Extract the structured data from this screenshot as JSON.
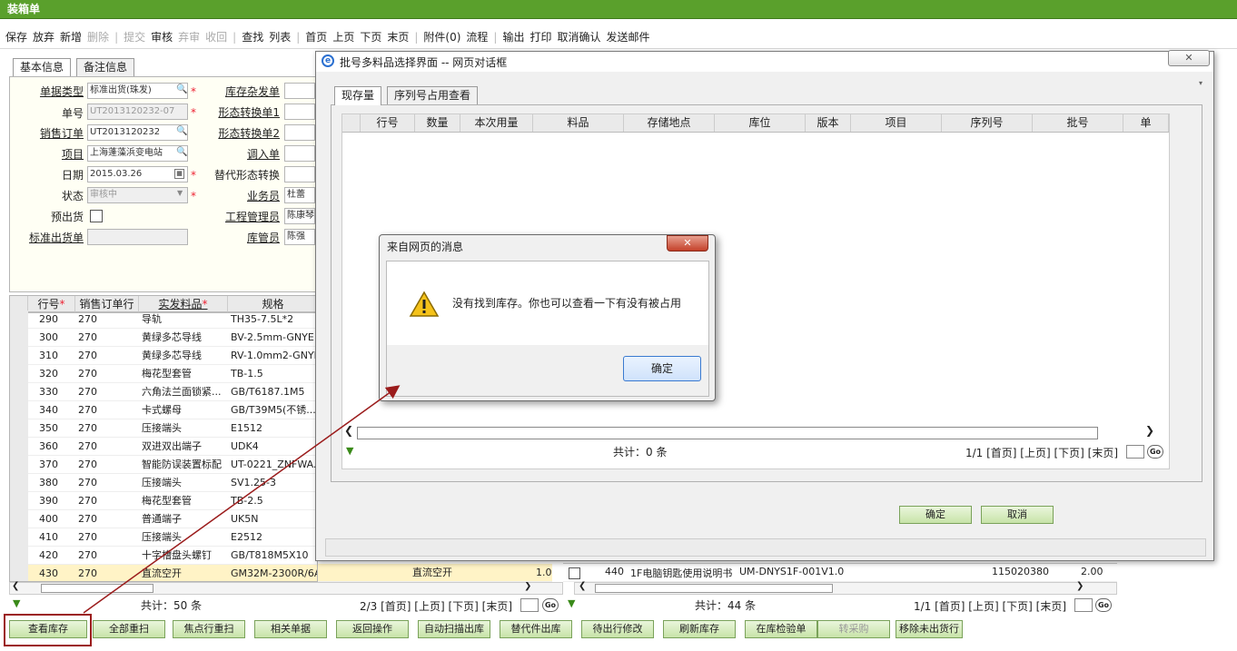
{
  "app": {
    "title": "装箱单"
  },
  "toolbar": [
    {
      "label": "保存",
      "enabled": true
    },
    {
      "label": "放弃",
      "enabled": true
    },
    {
      "label": "新增",
      "enabled": true
    },
    {
      "label": "删除",
      "enabled": false
    },
    {
      "sep": true
    },
    {
      "label": "提交",
      "enabled": false
    },
    {
      "label": "审核",
      "enabled": true
    },
    {
      "label": "弃审",
      "enabled": false
    },
    {
      "label": "收回",
      "enabled": false
    },
    {
      "sep": true
    },
    {
      "label": "查找",
      "enabled": true
    },
    {
      "label": "列表",
      "enabled": true
    },
    {
      "sep": true
    },
    {
      "label": "首页",
      "enabled": true
    },
    {
      "label": "上页",
      "enabled": true
    },
    {
      "label": "下页",
      "enabled": true
    },
    {
      "label": "末页",
      "enabled": true
    },
    {
      "sep": true
    },
    {
      "label": "附件(0)",
      "enabled": true
    },
    {
      "label": "流程",
      "enabled": true
    },
    {
      "sep": true
    },
    {
      "label": "输出",
      "enabled": true
    },
    {
      "label": "打印",
      "enabled": true
    },
    {
      "label": "取消确认",
      "enabled": true
    },
    {
      "label": "发送邮件",
      "enabled": true
    }
  ],
  "tabs": {
    "basic": "基本信息",
    "notes": "备注信息"
  },
  "form": {
    "doc_type_label": "单据类型",
    "doc_type": "标准出货(珠发)",
    "doc_no_label": "单号",
    "doc_no": "UT2013120232-07",
    "sales_order_label": "销售订单",
    "sales_order": "UT2013120232",
    "project_label": "项目",
    "project": "上海蓬藻浜变电站",
    "date_label": "日期",
    "date": "2015.03.26",
    "status_label": "状态",
    "status": "审核中",
    "preship_label": "预出货",
    "std_ship_label": "标准出货单",
    "stock_issue_label": "库存杂发单",
    "form_conv1_label": "形态转换单1",
    "form_conv2_label": "形态转换单2",
    "transfer_in_label": "调入单",
    "alt_form_label": "替代形态转换",
    "salesman_label": "业务员",
    "salesman": "杜蕾",
    "eng_mgr_label": "工程管理员",
    "eng_mgr": "陈康琴",
    "keeper_label": "库管员",
    "keeper": "陈强"
  },
  "left_grid": {
    "headers": [
      "行号",
      "销售订单行",
      "实发料品",
      "规格"
    ],
    "rows": [
      [
        "290",
        "270",
        "导轨",
        "TH35-7.5L*2"
      ],
      [
        "300",
        "270",
        "黄绿多芯导线",
        "BV-2.5mm-GNYE"
      ],
      [
        "310",
        "270",
        "黄绿多芯导线",
        "RV-1.0mm2-GNYE"
      ],
      [
        "320",
        "270",
        "梅花型套管",
        "TB-1.5"
      ],
      [
        "330",
        "270",
        "六角法兰面锁紧...",
        "GB/T6187.1M5"
      ],
      [
        "340",
        "270",
        "卡式螺母",
        "GB/T39M5(不锈..."
      ],
      [
        "350",
        "270",
        "压接端头",
        "E1512"
      ],
      [
        "360",
        "270",
        "双进双出端子",
        "UDK4"
      ],
      [
        "370",
        "270",
        "智能防误装置标配",
        "UT-0221_ZNFWA..."
      ],
      [
        "380",
        "270",
        "压接端头",
        "SV1.25-3"
      ],
      [
        "390",
        "270",
        "梅花型套管",
        "TB-2.5"
      ],
      [
        "400",
        "270",
        "普通端子",
        "UK5N"
      ],
      [
        "410",
        "270",
        "压接端头",
        "E2512"
      ],
      [
        "420",
        "270",
        "十字槽盘头螺钉",
        "GB/T818M5X10"
      ],
      [
        "430",
        "270",
        "直流空开",
        "GM32M-2300R/6A"
      ]
    ],
    "selected_extra": {
      "name": "直流空开",
      "qty": "1.0"
    },
    "total": "共计：50 条",
    "pager": "2/3 [首页] [上页] [下页] [末页]"
  },
  "right_grid": {
    "row": {
      "line": "440",
      "item": "1F电脑钥匙使用说明书",
      "spec": "UM-DNYS1F-001V1.0",
      "batch": "115020380",
      "qty": "2.00"
    },
    "total": "共计：44 条",
    "pager": "1/1 [首页] [上页] [下页] [末页]"
  },
  "bottom_buttons": [
    {
      "label": "查看库存",
      "enabled": true
    },
    {
      "label": "全部重扫",
      "enabled": true
    },
    {
      "label": "焦点行重扫",
      "enabled": true
    },
    {
      "label": "相关单据",
      "enabled": true
    },
    {
      "label": "返回操作",
      "enabled": true
    },
    {
      "label": "自动扫描出库",
      "enabled": true
    },
    {
      "label": "替代件出库",
      "enabled": true
    },
    {
      "label": "待出行修改",
      "enabled": true
    },
    {
      "label": "刷新库存",
      "enabled": true
    },
    {
      "label": "在库检验单",
      "enabled": true
    },
    {
      "label": "转采购",
      "enabled": false
    },
    {
      "label": "移除未出货行",
      "enabled": true
    }
  ],
  "dialog": {
    "title": "批号多料品选择界面 -- 网页对话框",
    "tabs": [
      "现存量",
      "序列号占用查看"
    ],
    "headers": [
      "行号",
      "数量",
      "本次用量",
      "料品",
      "存储地点",
      "库位",
      "版本",
      "项目",
      "序列号",
      "批号",
      "单"
    ],
    "total": "共计：0 条",
    "pager": "1/1 [首页] [上页] [下页] [末页]",
    "ok": "确定",
    "cancel": "取消"
  },
  "message": {
    "title": "来自网页的消息",
    "text": "没有找到库存。你也可以查看一下有没有被占用",
    "ok": "确定"
  },
  "colors": {
    "titlebar": "#5aa02c",
    "annotation": "#9b1c1c",
    "selected_row": "#fff3c6"
  }
}
